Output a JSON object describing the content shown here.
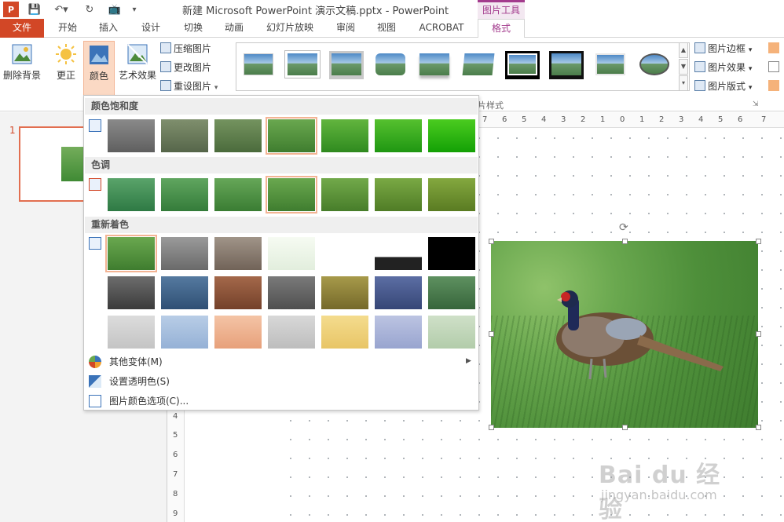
{
  "title_bar": {
    "title": "新建 Microsoft PowerPoint 演示文稿.pptx - PowerPoint",
    "context_group": "图片工具"
  },
  "tabs": [
    "文件",
    "开始",
    "插入",
    "设计",
    "切换",
    "动画",
    "幻灯片放映",
    "审阅",
    "视图",
    "ACROBAT",
    "格式"
  ],
  "ribbon": {
    "remove_background": "删除背景",
    "corrections": "更正",
    "color": "颜色",
    "artistic_effects": "艺术效果",
    "compress_pictures": "压缩图片",
    "change_picture": "更改图片",
    "reset_picture": "重设图片",
    "picture_border": "图片边框",
    "picture_effects": "图片效果",
    "picture_layout": "图片版式",
    "picture_styles_group": "片样式"
  },
  "color_menu": {
    "saturation_header": "颜色饱和度",
    "tone_header": "色调",
    "recolor_header": "重新着色",
    "more_variations": "其他变体(M)",
    "set_transparent": "设置透明色(S)",
    "color_options": "图片颜色选项(C)...",
    "selected_highlight": "#f3b494"
  },
  "slide_pane": {
    "slide_number": "1"
  },
  "ruler": {
    "top": [
      "7",
      "6",
      "5",
      "4",
      "3",
      "2",
      "1",
      "0",
      "1",
      "2",
      "3",
      "4",
      "5",
      "6",
      "7"
    ],
    "left": [
      "4",
      "5",
      "6",
      "7",
      "8",
      "9"
    ]
  },
  "watermark": {
    "logo": "Bai du 经验",
    "url": "jingyan.baidu.com"
  },
  "colors": {
    "file_tab": "#d24726",
    "format_accent": "#a33b8d"
  }
}
